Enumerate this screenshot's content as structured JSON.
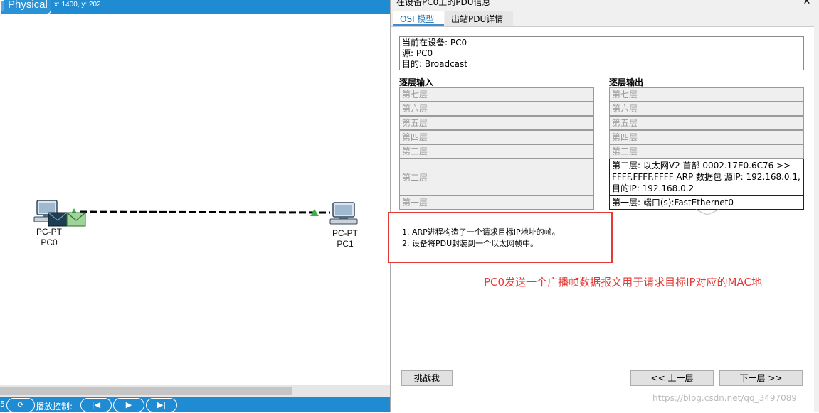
{
  "workspace": {
    "mode_tab": "Physical",
    "coords": "x: 1400, y: 202",
    "devices": [
      {
        "type": "PC-PT",
        "name": "PC0"
      },
      {
        "type": "PC-PT",
        "name": "PC1"
      }
    ],
    "bottom_num": "5",
    "playback_label": "播放控制:"
  },
  "dialog": {
    "title": "在设备PC0上的PDU信息",
    "close": "✕",
    "tabs": [
      "OSI 模型",
      "出站PDU详情"
    ],
    "info": {
      "line1": "当前在设备: PC0",
      "line2": "源: PC0",
      "line3": "目的: Broadcast"
    },
    "in_header": "逐层输入",
    "out_header": "逐层输出",
    "in_layers": [
      "第七层",
      "第六层",
      "第五层",
      "第四层",
      "第三层",
      "第二层",
      "第一层"
    ],
    "out_layers": [
      "第七层",
      "第六层",
      "第五层",
      "第四层",
      "第三层",
      "第二层: 以太网V2 首部 0002.17E0.6C76 >> FFFF.FFFF.FFFF ARP 数据包 源IP: 192.168.0.1, 目的IP: 192.168.0.2",
      "第一层: 端口(s):FastEthernet0"
    ],
    "description": [
      "1. ARP进程构造了一个请求目标IP地址的帧。",
      "2. 设备将PDU封装到一个以太网帧中。"
    ],
    "annotation": "PC0发送一个广播帧数据报文用于请求目标IP对应的MAC地",
    "buttons": {
      "challenge": "挑战我",
      "prev": "<< 上一层",
      "next": "下一层 >>"
    },
    "watermark": "https://blog.csdn.net/qq_3497089"
  },
  "colors": {
    "accent": "#1e8bd3",
    "annotation_red": "#e53935"
  }
}
